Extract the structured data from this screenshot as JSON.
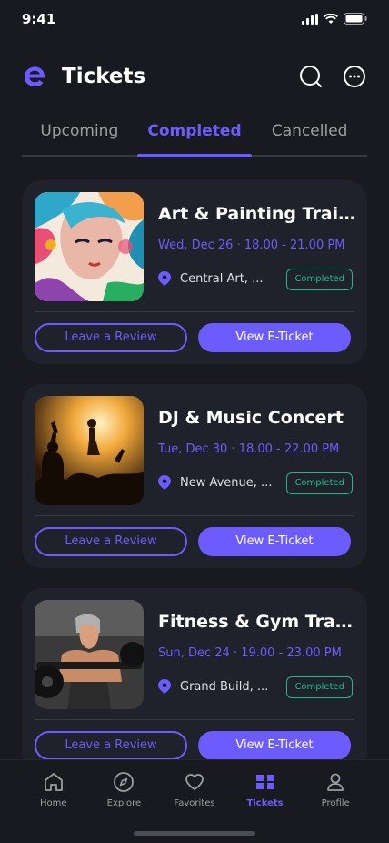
{
  "status": {
    "time": "9:41"
  },
  "header": {
    "title": "Tickets"
  },
  "tabs": [
    {
      "label": "Upcoming",
      "active": false
    },
    {
      "label": "Completed",
      "active": true
    },
    {
      "label": "Cancelled",
      "active": false
    }
  ],
  "tickets": [
    {
      "title": "Art & Painting Train...",
      "date": "Wed, Dec 26 · 18.00 - 21.00 PM",
      "location": "Central Art, ...",
      "status": "Completed",
      "review_label": "Leave a Review",
      "ticket_label": "View E-Ticket"
    },
    {
      "title": "DJ & Music Concert",
      "date": "Tue, Dec 30 · 18.00 - 22.00 PM",
      "location": "New Avenue, ...",
      "status": "Completed",
      "review_label": "Leave a Review",
      "ticket_label": "View E-Ticket"
    },
    {
      "title": "Fitness & Gym Train...",
      "date": "Sun, Dec 24 · 19.00 - 23.00 PM",
      "location": "Grand Build, ...",
      "status": "Completed",
      "review_label": "Leave a Review",
      "ticket_label": "View E-Ticket"
    }
  ],
  "bottom_nav": [
    {
      "label": "Home",
      "icon": "home-icon",
      "active": false
    },
    {
      "label": "Explore",
      "icon": "compass-icon",
      "active": false
    },
    {
      "label": "Favorites",
      "icon": "heart-icon",
      "active": false
    },
    {
      "label": "Tickets",
      "icon": "ticket-icon",
      "active": true
    },
    {
      "label": "Profile",
      "icon": "profile-icon",
      "active": false
    }
  ],
  "colors": {
    "accent": "#6C5CFF",
    "background": "#181A20",
    "card": "#1F222A",
    "success": "#1ABC8C"
  }
}
